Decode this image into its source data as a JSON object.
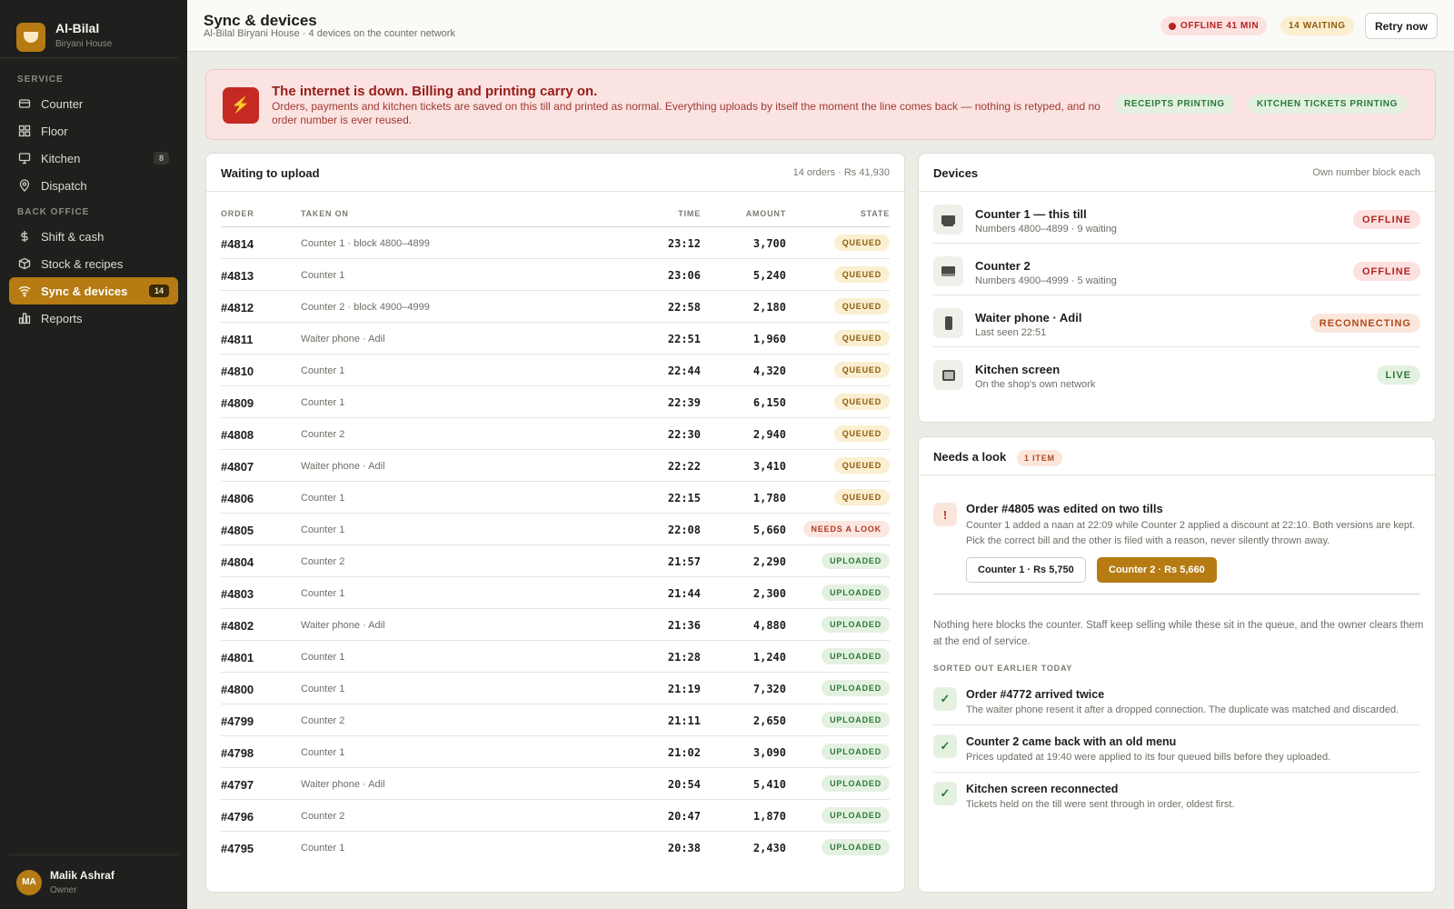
{
  "brand": {
    "name": "Al-Bilal",
    "subtitle": "Biryani House"
  },
  "nav": {
    "sections": [
      {
        "label": "SERVICE",
        "items": [
          {
            "label": "Counter",
            "icon": "counter-icon"
          },
          {
            "label": "Floor",
            "icon": "floor-grid-icon"
          },
          {
            "label": "Kitchen",
            "icon": "kitchen-monitor-icon",
            "count": "8"
          },
          {
            "label": "Dispatch",
            "icon": "location-pin-icon"
          }
        ]
      },
      {
        "label": "BACK OFFICE",
        "items": [
          {
            "label": "Shift & cash",
            "icon": "dollar-icon"
          },
          {
            "label": "Stock & recipes",
            "icon": "box-icon"
          },
          {
            "label": "Sync & devices",
            "icon": "wifi-icon",
            "count": "14",
            "active": true
          },
          {
            "label": "Reports",
            "icon": "bar-chart-icon"
          }
        ]
      }
    ]
  },
  "user": {
    "initials": "MA",
    "name": "Malik Ashraf",
    "role": "Owner"
  },
  "header": {
    "title": "Sync & devices",
    "subtitle": "Al-Bilal Biryani House · 4 devices on the counter network",
    "offline_label": "OFFLINE 41 MIN",
    "waiting_label": "14 WAITING",
    "retry_label": "Retry now"
  },
  "banner": {
    "icon": "lightning-icon",
    "title": "The internet is down. Billing and printing carry on.",
    "text": "Orders, payments and kitchen tickets are saved on this till and printed as normal. Everything uploads by itself the moment the line comes back — nothing is retyped, and no order number is ever reused.",
    "chips": [
      "RECEIPTS PRINTING",
      "KITCHEN TICKETS PRINTING"
    ]
  },
  "queue": {
    "title": "Waiting to upload",
    "meta": "14 orders · Rs 41,930",
    "columns": {
      "order": "ORDER",
      "taken": "TAKEN ON",
      "time": "TIME",
      "amount": "AMOUNT",
      "state": "STATE"
    },
    "rows": [
      {
        "order": "#4814",
        "taken": "Counter 1 · block 4800–4899",
        "time": "23:12",
        "amount": "3,700",
        "state": "QUEUED"
      },
      {
        "order": "#4813",
        "taken": "Counter 1",
        "time": "23:06",
        "amount": "5,240",
        "state": "QUEUED"
      },
      {
        "order": "#4812",
        "taken": "Counter 2 · block 4900–4999",
        "time": "22:58",
        "amount": "2,180",
        "state": "QUEUED"
      },
      {
        "order": "#4811",
        "taken": "Waiter phone · Adil",
        "time": "22:51",
        "amount": "1,960",
        "state": "QUEUED"
      },
      {
        "order": "#4810",
        "taken": "Counter 1",
        "time": "22:44",
        "amount": "4,320",
        "state": "QUEUED"
      },
      {
        "order": "#4809",
        "taken": "Counter 1",
        "time": "22:39",
        "amount": "6,150",
        "state": "QUEUED"
      },
      {
        "order": "#4808",
        "taken": "Counter 2",
        "time": "22:30",
        "amount": "2,940",
        "state": "QUEUED"
      },
      {
        "order": "#4807",
        "taken": "Waiter phone · Adil",
        "time": "22:22",
        "amount": "3,410",
        "state": "QUEUED"
      },
      {
        "order": "#4806",
        "taken": "Counter 1",
        "time": "22:15",
        "amount": "1,780",
        "state": "QUEUED"
      },
      {
        "order": "#4805",
        "taken": "Counter 1",
        "time": "22:08",
        "amount": "5,660",
        "state": "NEEDS A LOOK"
      },
      {
        "order": "#4804",
        "taken": "Counter 2",
        "time": "21:57",
        "amount": "2,290",
        "state": "UPLOADED"
      },
      {
        "order": "#4803",
        "taken": "Counter 1",
        "time": "21:44",
        "amount": "2,300",
        "state": "UPLOADED"
      },
      {
        "order": "#4802",
        "taken": "Waiter phone · Adil",
        "time": "21:36",
        "amount": "4,880",
        "state": "UPLOADED"
      },
      {
        "order": "#4801",
        "taken": "Counter 1",
        "time": "21:28",
        "amount": "1,240",
        "state": "UPLOADED"
      },
      {
        "order": "#4800",
        "taken": "Counter 1",
        "time": "21:19",
        "amount": "7,320",
        "state": "UPLOADED"
      },
      {
        "order": "#4799",
        "taken": "Counter 2",
        "time": "21:11",
        "amount": "2,650",
        "state": "UPLOADED"
      },
      {
        "order": "#4798",
        "taken": "Counter 1",
        "time": "21:02",
        "amount": "3,090",
        "state": "UPLOADED"
      },
      {
        "order": "#4797",
        "taken": "Waiter phone · Adil",
        "time": "20:54",
        "amount": "5,410",
        "state": "UPLOADED"
      },
      {
        "order": "#4796",
        "taken": "Counter 2",
        "time": "20:47",
        "amount": "1,870",
        "state": "UPLOADED"
      },
      {
        "order": "#4795",
        "taken": "Counter 1",
        "time": "20:38",
        "amount": "2,430",
        "state": "UPLOADED"
      }
    ]
  },
  "devices": {
    "title": "Devices",
    "meta": "Own number block each",
    "items": [
      {
        "name": "Counter 1 — this till",
        "sub": "Numbers 4800–4899 · 9 waiting",
        "state": "OFFLINE",
        "icon": "desktop-icon"
      },
      {
        "name": "Counter 2",
        "sub": "Numbers 4900–4999 · 5 waiting",
        "state": "OFFLINE",
        "icon": "laptop-icon"
      },
      {
        "name": "Waiter phone · Adil",
        "sub": "Last seen 22:51",
        "state": "RECONNECTING",
        "icon": "phone-icon"
      },
      {
        "name": "Kitchen screen",
        "sub": "On the shop's own network",
        "state": "LIVE",
        "icon": "kitchen-screen-icon"
      }
    ]
  },
  "needs": {
    "title": "Needs a look",
    "count": "1 ITEM",
    "issue": {
      "icon": "alert-icon",
      "title": "Order #4805 was edited on two tills",
      "text": "Counter 1 added a naan at 22:09 while Counter 2 applied a discount at 22:10. Both versions are kept. Pick the correct bill and the other is filed with a reason, never silently thrown away.",
      "choice_1": "Counter 1 · Rs 5,750",
      "choice_2": "Counter 2 · Rs 5,660"
    },
    "note": "Nothing here blocks the counter. Staff keep selling while these sit in the queue, and the owner clears them at the end of service.",
    "sorted_heading": "SORTED OUT EARLIER TODAY",
    "resolved": [
      {
        "title": "Order #4772 arrived twice",
        "text": "The waiter phone resent it after a dropped connection. The duplicate was matched and discarded."
      },
      {
        "title": "Counter 2 came back with an old menu",
        "text": "Prices updated at 19:40 were applied to its four queued bills before they uploaded."
      },
      {
        "title": "Kitchen screen reconnected",
        "text": "Tickets held on the till were sent through in order, oldest first."
      }
    ]
  },
  "colors": {
    "accent": "#b67b13",
    "sidebar": "#1f201d",
    "offline": "#b32421",
    "queued": "#8c5c0b",
    "uploaded": "#2b7a3d"
  }
}
